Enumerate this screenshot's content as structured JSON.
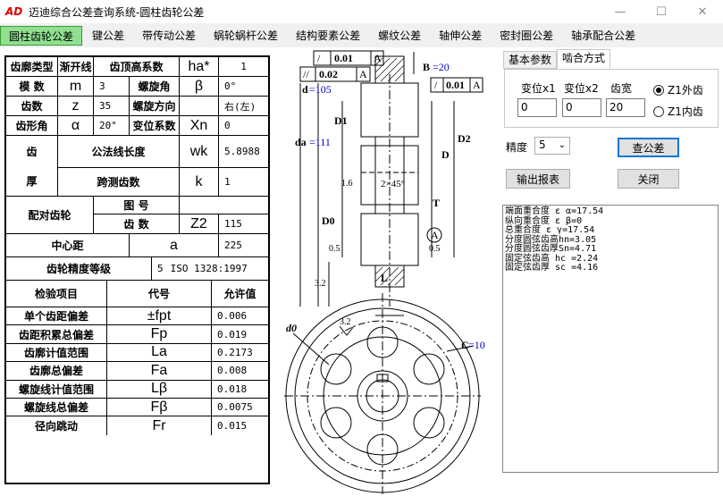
{
  "window": {
    "title": "迈迪综合公差查询系统-圆柱齿轮公差",
    "logo": "AD"
  },
  "tabs": [
    "圆柱齿轮公差",
    "键公差",
    "带传动公差",
    "蜗轮蜗杆公差",
    "结构要素公差",
    "螺纹公差",
    "轴伸公差",
    "密封圈公差",
    "轴承配合公差"
  ],
  "active_tab": 0,
  "params": {
    "r1": {
      "l1": "齿廓类型",
      "v1": "渐开线",
      "l2": "齿顶高系数",
      "s2": "ha*",
      "v2": "1"
    },
    "r2": {
      "l1": "模  数",
      "s1": "m",
      "v1": "3",
      "l2": "螺旋角",
      "s2": "β",
      "v2": "0°"
    },
    "r3": {
      "l1": "齿数",
      "s1": "z",
      "v1": "35",
      "l2": "螺旋方向",
      "v2": "右(左)"
    },
    "r4": {
      "l1": "齿形角",
      "s1": "α",
      "v1": "20°",
      "l2": "变位系数",
      "s2": "Xn",
      "v2": "0"
    },
    "thick": {
      "c1": "齿",
      "c2": "厚",
      "a_label": "公法线长度",
      "a_sym": "wk",
      "a_val": "5.8988",
      "b_label": "跨测齿数",
      "b_sym": "k",
      "b_val": "1"
    },
    "pair": {
      "label": "配对齿轮",
      "fig_label": "图 号",
      "teeth_label": "齿  数",
      "teeth_sym": "Z2",
      "teeth_val": "115"
    },
    "center": {
      "label": "中心距",
      "sym": "a",
      "val": "225"
    },
    "accuracy": {
      "label": "齿轮精度等级",
      "grade": "5",
      "std": "ISO 1328:1997"
    }
  },
  "tol_header": {
    "item": "检验项目",
    "code": "代号",
    "val": "允许值"
  },
  "tolerances": [
    {
      "item": "单个齿距偏差",
      "code": "±fpt",
      "val": "0.006"
    },
    {
      "item": "齿距积累总偏差",
      "code": "Fp",
      "val": "0.019"
    },
    {
      "item": "齿廓计值范围",
      "code": "La",
      "val": "0.2173"
    },
    {
      "item": "齿廓总偏差",
      "code": "Fa",
      "val": "0.008"
    },
    {
      "item": "螺旋线计值范围",
      "code": "Lβ",
      "val": "0.018"
    },
    {
      "item": "螺旋线总偏差",
      "code": "Fβ",
      "val": "0.0075"
    },
    {
      "item": "径向跳动",
      "code": "Fr",
      "val": "0.015"
    }
  ],
  "drawing": {
    "fcf_top_sym": "/",
    "fcf_top_val": "0.01",
    "fcf_top_ref": "A",
    "fcf_mid_sym": "//",
    "fcf_mid_val": "0.02",
    "fcf_mid_ref": "A",
    "fcf_right_sym": "/",
    "fcf_right_val": "0.01",
    "fcf_right_ref": "A",
    "d_label": "d",
    "d_val": "=105",
    "b_label": "B",
    "b_val": "=20",
    "da_label": "da",
    "da_val": "=111",
    "D1": "D1",
    "D2": "D2",
    "D": "D",
    "D0": "D0",
    "rough1": "1.6",
    "chamfer": "2×45°",
    "rough2": "0.5",
    "rough3": "0.5",
    "rough4": "3.2",
    "T": "T",
    "A": "A",
    "L": "L",
    "d0": "d0",
    "rough5": "3.2",
    "C_label": "C",
    "C_val": "=10"
  },
  "right_panel": {
    "tabs": [
      "基本参数",
      "啮合方式"
    ],
    "active": 1,
    "x1_label": "变位x1",
    "x2_label": "变位x2",
    "w_label": "齿宽",
    "x1_val": "0",
    "x2_val": "0",
    "w_val": "20",
    "r_ext": "Z1外齿",
    "r_int": "Z1内齿",
    "precision_label": "精度",
    "precision_val": "5",
    "btn_query": "查公差",
    "btn_report": "输出报表",
    "btn_close": "关闭"
  },
  "results": [
    "端面重合度 ε α=17.54",
    "纵向重合度 ε β=0",
    "总重合度 ε γ=17.54",
    "分度圆弦齿高hn=3.05",
    "分度圆弦齿厚Sn=4.71",
    "固定弦齿高  hc =2.24",
    "固定弦齿厚  sc =4.16"
  ],
  "colors": {
    "active_tab_bg": "#8fe08f",
    "accent": "#0078d7",
    "blue_text": "#0000cc"
  }
}
